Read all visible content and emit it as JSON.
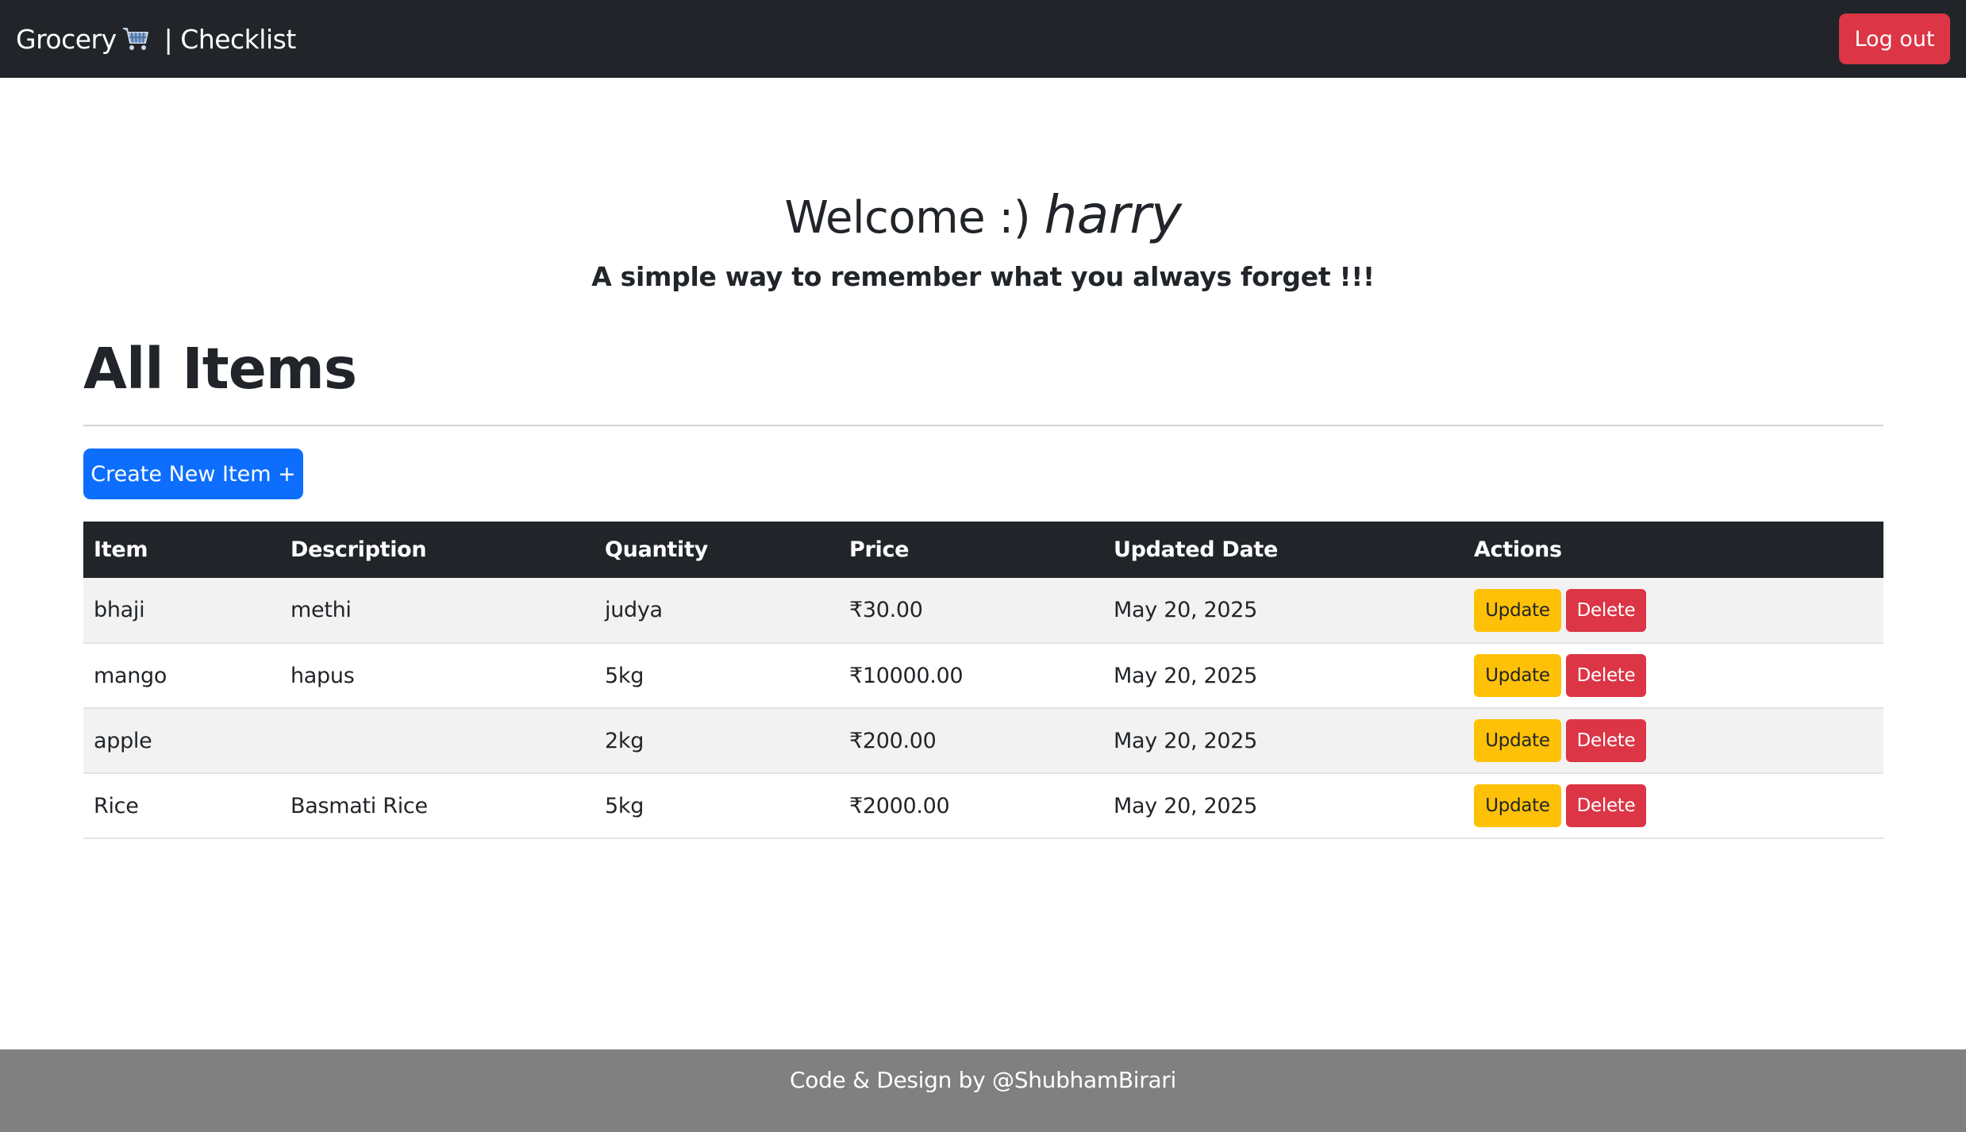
{
  "navbar": {
    "brand_text": "Grocery",
    "brand_icon": "shopping-cart-icon",
    "brand_separator": "|",
    "brand_subtitle": "Checklist",
    "logout_label": "Log out"
  },
  "hero": {
    "welcome_text": "Welcome :)",
    "username": "harry",
    "tagline": "A simple way to remember what you always forget !!!"
  },
  "main": {
    "section_title": "All Items",
    "create_button_label": "Create New Item +",
    "table": {
      "headers": [
        "Item",
        "Description",
        "Quantity",
        "Price",
        "Updated Date",
        "Actions"
      ],
      "rows": [
        {
          "item": "bhaji",
          "description": "methi",
          "quantity": "judya",
          "price": "₹30.00",
          "updated": "May 20, 2025"
        },
        {
          "item": "mango",
          "description": "hapus",
          "quantity": "5kg",
          "price": "₹10000.00",
          "updated": "May 20, 2025"
        },
        {
          "item": "apple",
          "description": "",
          "quantity": "2kg",
          "price": "₹200.00",
          "updated": "May 20, 2025"
        },
        {
          "item": "Rice",
          "description": "Basmati Rice",
          "quantity": "5kg",
          "price": "₹2000.00",
          "updated": "May 20, 2025"
        }
      ],
      "update_label": "Update",
      "delete_label": "Delete"
    }
  },
  "footer": {
    "credit": "Code & Design by @ShubhamBirari"
  },
  "colors": {
    "navbar_bg": "#212529",
    "primary": "#0d6efd",
    "danger": "#dc3545",
    "warning": "#ffc107",
    "footer_bg": "#808080"
  }
}
